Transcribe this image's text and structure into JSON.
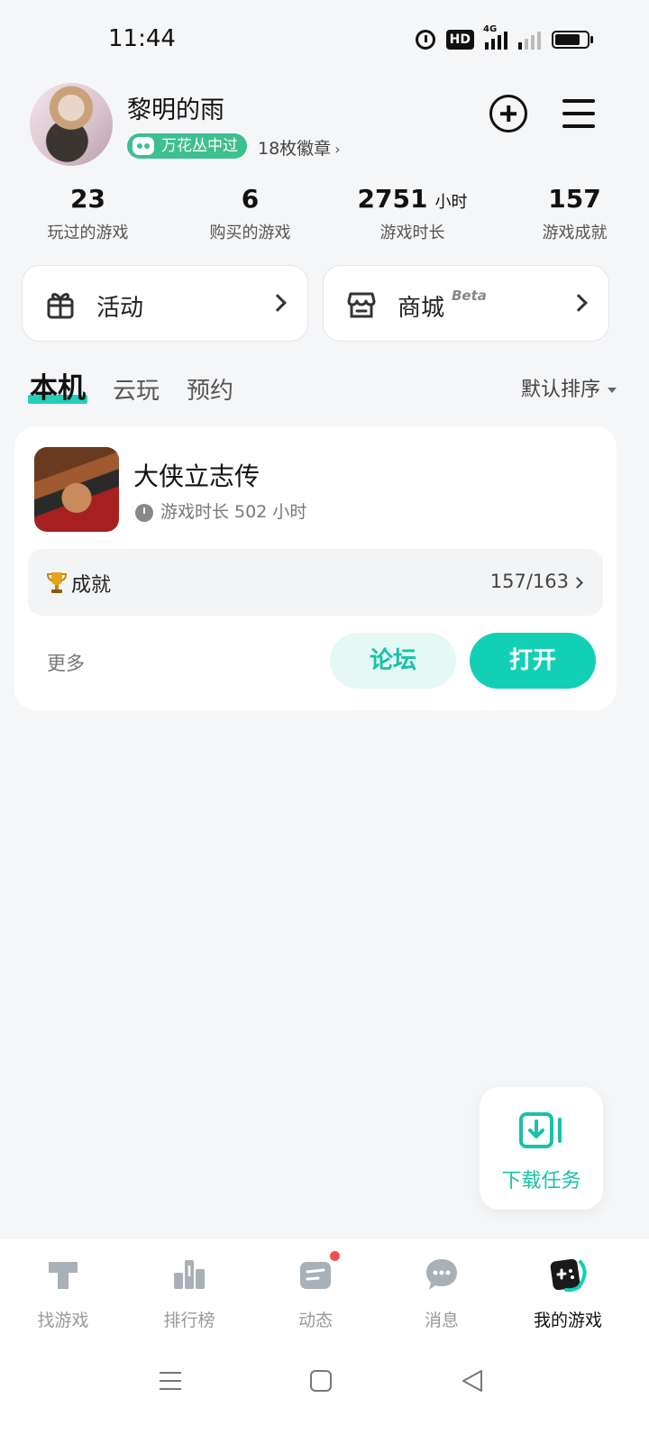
{
  "status_bar": {
    "time": "11:44",
    "hd_label": "HD",
    "network_label": "4G",
    "icons": [
      "alarm-icon",
      "hd-icon",
      "signal-icon",
      "signal-weak-icon",
      "battery-icon"
    ]
  },
  "profile": {
    "username": "黎明的雨",
    "badge_label": "万花丛中过",
    "medals_label": "18枚徽章",
    "medals_chevron": "›"
  },
  "stats": [
    {
      "value": "23",
      "unit": "",
      "label": "玩过的游戏"
    },
    {
      "value": "6",
      "unit": "",
      "label": "购买的游戏"
    },
    {
      "value": "2751",
      "unit": "小时",
      "label": "游戏时长"
    },
    {
      "value": "157",
      "unit": "",
      "label": "游戏成就"
    }
  ],
  "shortcuts": {
    "activity": {
      "label": "活动",
      "icon": "gift-icon"
    },
    "store": {
      "label": "商城",
      "tag": "Beta",
      "icon": "store-icon"
    }
  },
  "tabs": [
    {
      "label": "本机",
      "active": true
    },
    {
      "label": "云玩",
      "active": false
    },
    {
      "label": "预约",
      "active": false
    }
  ],
  "sort_label": "默认排序",
  "game": {
    "title": "大侠立志传",
    "playtime": "游戏时长 502 小时",
    "achievement_label": "成就",
    "achievement_value": "157/163",
    "more_label": "更多",
    "forum_label": "论坛",
    "open_label": "打开"
  },
  "download_task_label": "下载任务",
  "bottom_nav": [
    {
      "label": "找游戏",
      "icon": "find-game-icon",
      "active": false
    },
    {
      "label": "排行榜",
      "icon": "ranking-icon",
      "active": false
    },
    {
      "label": "动态",
      "icon": "feed-icon",
      "active": false,
      "has_dot": true
    },
    {
      "label": "消息",
      "icon": "message-icon",
      "active": false
    },
    {
      "label": "我的游戏",
      "icon": "my-games-icon",
      "active": true
    }
  ],
  "colors": {
    "accent": "#12d0b6",
    "accent_light": "#e4f8f5",
    "badge_green": "#3dbf8f",
    "notify_red": "#f24e4e",
    "background": "#f5f6f8"
  }
}
